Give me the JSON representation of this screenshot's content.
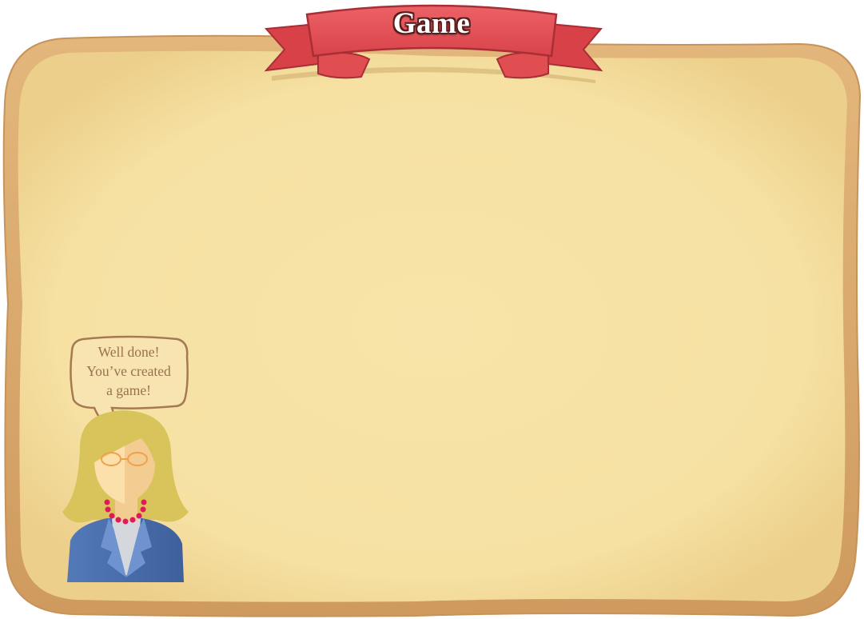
{
  "game": {
    "title": "Game"
  },
  "character": {
    "speech_lines": [
      "Well done!",
      "You’ve created",
      "a game!"
    ]
  },
  "colors": {
    "board_fill": "#f8e4a8",
    "board_frame": "#d9a86a",
    "ribbon": "#e04e52",
    "speech_text": "#9a7150",
    "hair": "#d8c45a",
    "suit": "#4a6fae",
    "necklace": "#e01a58"
  }
}
